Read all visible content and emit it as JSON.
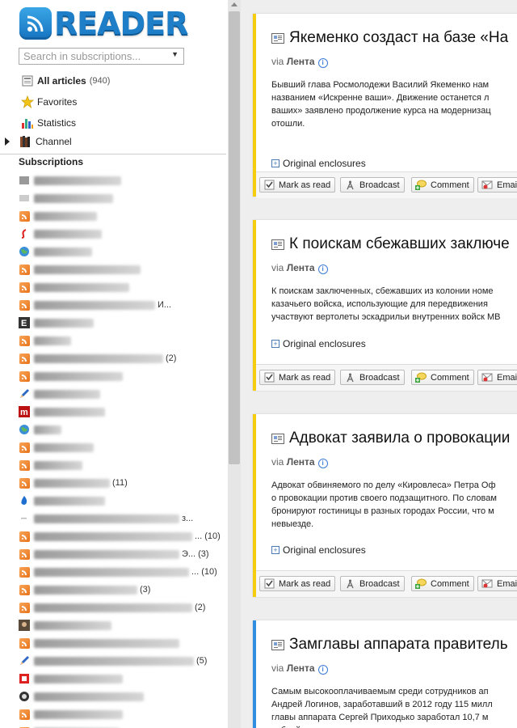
{
  "app": {
    "logo_text": "READER"
  },
  "search": {
    "placeholder": "Search in subscriptions..."
  },
  "nav": {
    "all_label": "All articles",
    "all_count": "(940)",
    "favorites_label": "Favorites",
    "statistics_label": "Statistics",
    "channel_label": "Channel"
  },
  "subscriptions": {
    "header": "Subscriptions",
    "items": [
      {
        "icon": "globe-dark-icon",
        "tail": ""
      },
      {
        "icon": "blurred-icon",
        "tail": ""
      },
      {
        "icon": "rss-icon",
        "tail": ""
      },
      {
        "icon": "red-swirl-icon",
        "tail": ""
      },
      {
        "icon": "globe-icon",
        "tail": ""
      },
      {
        "icon": "rss-icon",
        "tail": ""
      },
      {
        "icon": "rss-icon",
        "tail": ""
      },
      {
        "icon": "rss-icon",
        "tail": "И..."
      },
      {
        "icon": "e-logo-icon",
        "tail": ""
      },
      {
        "icon": "rss-icon",
        "tail": ""
      },
      {
        "icon": "rss-icon",
        "tail": "(2)"
      },
      {
        "icon": "rss-icon",
        "tail": ""
      },
      {
        "icon": "pencil-icon",
        "tail": ""
      },
      {
        "icon": "m-logo-icon",
        "tail": ""
      },
      {
        "icon": "globe-icon",
        "tail": ""
      },
      {
        "icon": "rss-icon",
        "tail": ""
      },
      {
        "icon": "rss-icon",
        "tail": ""
      },
      {
        "icon": "rss-icon",
        "tail": "(11)"
      },
      {
        "icon": "blue-drop-icon",
        "tail": ""
      },
      {
        "icon": "dash-icon",
        "tail": "з..."
      },
      {
        "icon": "rss-icon",
        "tail": "... (10)"
      },
      {
        "icon": "rss-icon",
        "tail": "Э... (3)"
      },
      {
        "icon": "rss-icon",
        "tail": "... (10)"
      },
      {
        "icon": "rss-icon",
        "tail": "(3)"
      },
      {
        "icon": "rss-icon",
        "tail": "(2)"
      },
      {
        "icon": "photo-icon",
        "tail": ""
      },
      {
        "icon": "rss-icon",
        "tail": ""
      },
      {
        "icon": "pencil-icon",
        "tail": "(5)"
      },
      {
        "icon": "red-square-icon",
        "tail": ""
      },
      {
        "icon": "camera-icon",
        "tail": ""
      },
      {
        "icon": "rss-icon",
        "tail": ""
      },
      {
        "icon": "rss-icon",
        "tail": ""
      }
    ]
  },
  "articles": [
    {
      "title": "Якеменко создаст на базе «На",
      "via_prefix": "via",
      "source": "Лента",
      "body": [
        "Бывший глава Росмолодежи Василий Якеменко нам",
        "названием «Искренне ваши». Движение останется л",
        "ваших» заявлено продолжение курса на модернизац",
        "отошли."
      ],
      "enclosures_label": "Original enclosures",
      "accent": "#f5cc10"
    },
    {
      "title": "К поискам сбежавших заключе",
      "via_prefix": "via",
      "source": "Лента",
      "body": [
        "К поискам заключенных, сбежавших из колонии номе",
        "казачьего войска, использующие для передвижения",
        "участвуют вертолеты эскадрильи внутренних войск МВ"
      ],
      "enclosures_label": "Original enclosures",
      "accent": "#f5cc10"
    },
    {
      "title": "Адвокат заявила о провокации",
      "via_prefix": "via",
      "source": "Лента",
      "body": [
        "Адвокат обвиняемого по делу «Кировлеса» Петра Оф",
        "о провокации против своего подзащитного. По словам",
        "бронируют гостиницы в разных городах России, что м",
        "невыезде."
      ],
      "enclosures_label": "Original enclosures",
      "accent": "#f5cc10"
    },
    {
      "title": "Замглавы аппарата правитель",
      "via_prefix": "via",
      "source": "Лента",
      "body": [
        "Самым высокооплачиваемым среди сотрудников ап",
        "Андрей Логинов, заработавший в 2012 году 115 милл",
        "главы аппарата Сергей Приходько заработал 10,7 м",
        "рублей"
      ],
      "enclosures_label": "",
      "accent": "#2f8ee0"
    }
  ],
  "actions": {
    "mark_read": "Mark as read",
    "broadcast": "Broadcast",
    "comment": "Comment",
    "email": "Email"
  }
}
